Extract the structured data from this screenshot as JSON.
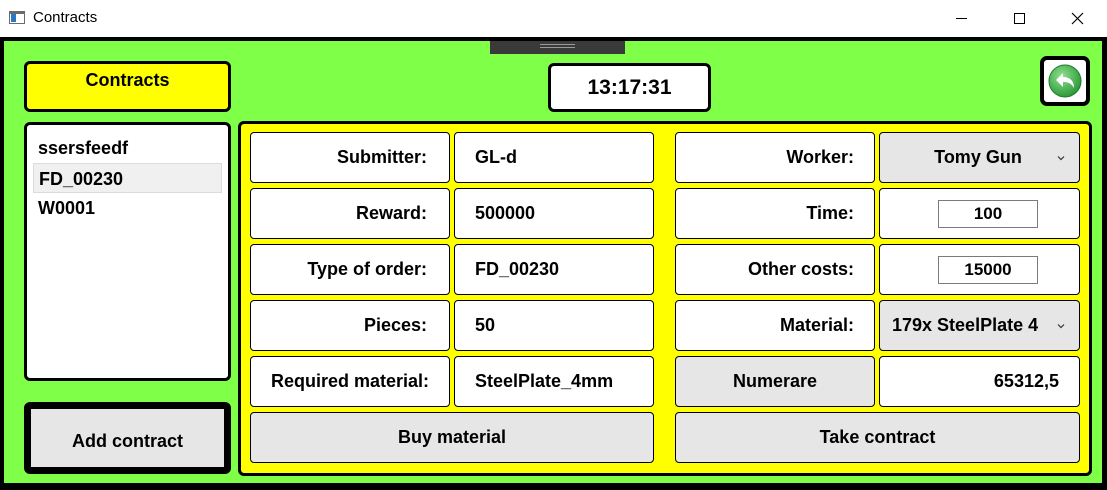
{
  "window": {
    "title": "Contracts",
    "icon": "app-window-icon",
    "controls": [
      "minimize-icon",
      "maximize-icon",
      "close-icon"
    ]
  },
  "colors": {
    "background": "#80ff48",
    "panel": "#ffff00",
    "button": "#e6e6e6",
    "border": "#000000"
  },
  "sidebar": {
    "header": "Contracts",
    "items": [
      {
        "label": "ssersfeedf",
        "selected": false
      },
      {
        "label": "FD_00230",
        "selected": true
      },
      {
        "label": "W0001",
        "selected": false
      }
    ],
    "add_button": "Add contract"
  },
  "clock": "13:17:31",
  "back_button_icon": "back-arrow-icon",
  "details": {
    "submitter": {
      "label": "Submitter:",
      "value": "GL-d"
    },
    "reward": {
      "label": "Reward:",
      "value": "500000"
    },
    "order_type": {
      "label": "Type of order:",
      "value": "FD_00230"
    },
    "pieces": {
      "label": "Pieces:",
      "value": "50"
    },
    "required_material": {
      "label": "Required material:",
      "value": "SteelPlate_4mm"
    },
    "buy_button": "Buy material"
  },
  "assignment": {
    "worker": {
      "label": "Worker:",
      "value": "Tomy Gun"
    },
    "time": {
      "label": "Time:",
      "value": "100"
    },
    "other_costs": {
      "label": "Other costs:",
      "value": "15000"
    },
    "material": {
      "label": "Material:",
      "value": "179x SteelPlate 4"
    },
    "numerare_button": "Numerare",
    "numerare_value": "65312,5",
    "take_button": "Take contract"
  }
}
